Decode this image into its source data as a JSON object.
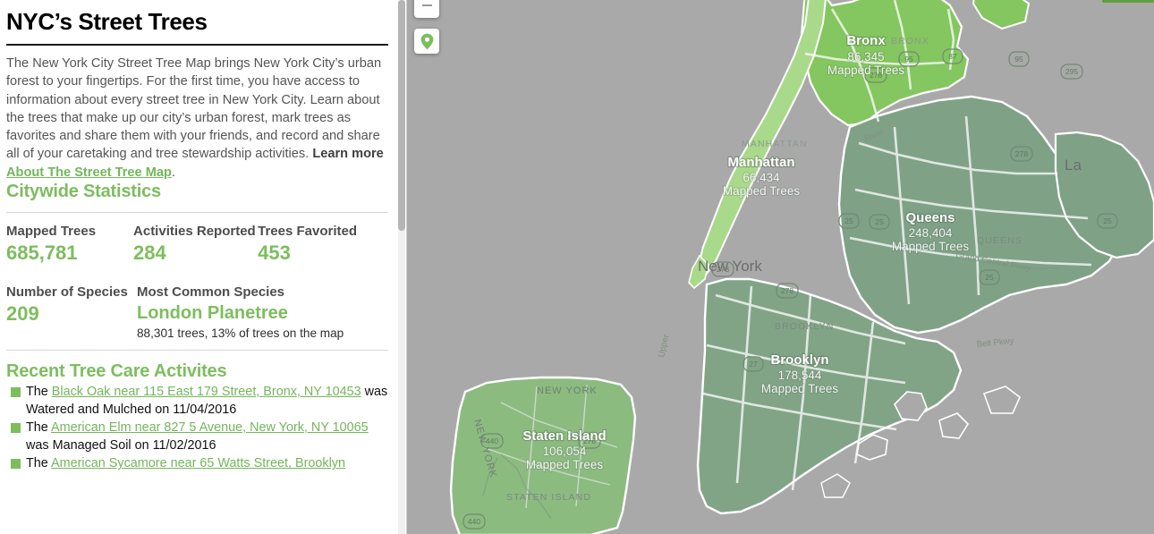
{
  "panel": {
    "title": "NYC’s Street Trees",
    "intro": {
      "text": "The New York City Street Tree Map brings New York City’s urban forest to your fingertips. For the first time, you have access to information about every street tree in New York City. Learn about the trees that make up our city’s urban forest, mark trees as favorites and share them with your friends, and record and share all of your caretaking and tree stewardship activities. ",
      "bold_lead": "Learn more ",
      "link": "About The Street Tree Map",
      "period": "."
    },
    "statistics": {
      "heading": "Citywide Statistics",
      "items": [
        {
          "label": "Mapped Trees",
          "value": "685,781"
        },
        {
          "label": "Activities Reported",
          "value": "284"
        },
        {
          "label": "Trees Favorited",
          "value": "453"
        },
        {
          "label": "Number of Species",
          "value": "209"
        },
        {
          "label": "Most Common Species",
          "value": "London Planetree",
          "sub": "88,301 trees, 13% of trees on the map"
        }
      ]
    },
    "activities": {
      "heading": "Recent Tree Care Activites",
      "items": [
        {
          "prefix": "The ",
          "link": "Black Oak near 115 East 179 Street, Bronx, NY 10453",
          "suffix": " was Watered and Mulched on 11/04/2016"
        },
        {
          "prefix": "The ",
          "link": "American Elm near 827 5 Avenue, New York, NY 10065",
          "suffix": " was Managed Soil on 11/02/2016"
        },
        {
          "prefix": "The ",
          "link": "American Sycamore near 65 Watts Street, Brooklyn",
          "suffix": ""
        }
      ]
    },
    "scrollbar": {
      "visible": "true"
    }
  },
  "map": {
    "controls": {
      "zoom_out": "−",
      "locate": "locate-pin",
      "top_right_bar": ""
    },
    "boroughs": [
      {
        "name": "Bronx",
        "count": "86,345",
        "unit": "Mapped Trees",
        "color": "#84c65f"
      },
      {
        "name": "Manhattan",
        "count": "66,434",
        "unit": "Mapped Trees",
        "color": "#a9d98a"
      },
      {
        "name": "Queens",
        "count": "248,404",
        "unit": "Mapped Trees",
        "color": "#7fa287"
      },
      {
        "name": "Brooklyn",
        "count": "178,544",
        "unit": "Mapped Trees",
        "color": "#81a487"
      },
      {
        "name": "Staten Island",
        "count": "106,054",
        "unit": "Mapped Trees",
        "color": "#8cbb80"
      }
    ],
    "place_labels": [
      "BRONX",
      "MANHATTAN",
      "QUEENS",
      "BROOKLYN",
      "STATEN ISLAND",
      "New York",
      "NEW YORK",
      "NEW YORK",
      "La"
    ],
    "route_shields": [
      "95",
      "95",
      "295",
      "278",
      "278",
      "278",
      "87",
      "25",
      "25",
      "27",
      "440",
      "440"
    ],
    "road_labels": [
      "Grand Central Pkwy",
      "Belt Pkwy",
      "Upper ...",
      "...River"
    ],
    "colors": {
      "water_land": "#a9a9a9",
      "bright_green": "#84c65f",
      "sage_green": "#7fa287",
      "panel_bg": "#ffffff",
      "accent_green": "#7dbd5e",
      "link_green": "#74b65b"
    }
  }
}
